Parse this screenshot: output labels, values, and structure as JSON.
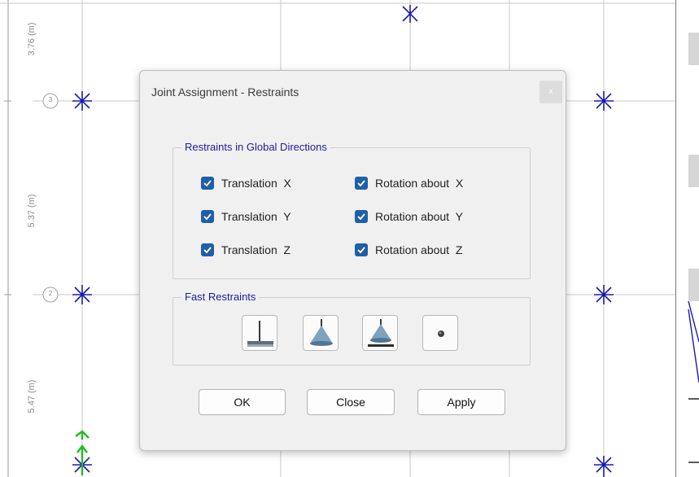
{
  "background": {
    "dims": [
      "3.76 (m)",
      "5.37 (m)",
      "5.47 (m)"
    ],
    "grid_bubbles": [
      "3",
      "2"
    ]
  },
  "dialog": {
    "title": "Joint Assignment - Restraints",
    "close_glyph": "x",
    "restraints_group": {
      "title": "Restraints in Global Directions",
      "items": [
        {
          "label": "Translation  X",
          "checked": true
        },
        {
          "label": "Translation  Y",
          "checked": true
        },
        {
          "label": "Translation  Z",
          "checked": true
        },
        {
          "label": "Rotation about  X",
          "checked": true
        },
        {
          "label": "Rotation about  Y",
          "checked": true
        },
        {
          "label": "Rotation about  Z",
          "checked": true
        }
      ]
    },
    "fast_group": {
      "title": "Fast Restraints",
      "buttons": [
        "fixed-support-icon",
        "pinned-support-icon",
        "roller-support-icon",
        "free-joint-icon"
      ]
    },
    "buttons": {
      "ok": "OK",
      "close": "Close",
      "apply": "Apply"
    }
  },
  "colors": {
    "accent": "#1f5fa8",
    "group_title": "#1c1c9a",
    "joint": "#1a1ab0",
    "support_green": "#22bb22"
  }
}
